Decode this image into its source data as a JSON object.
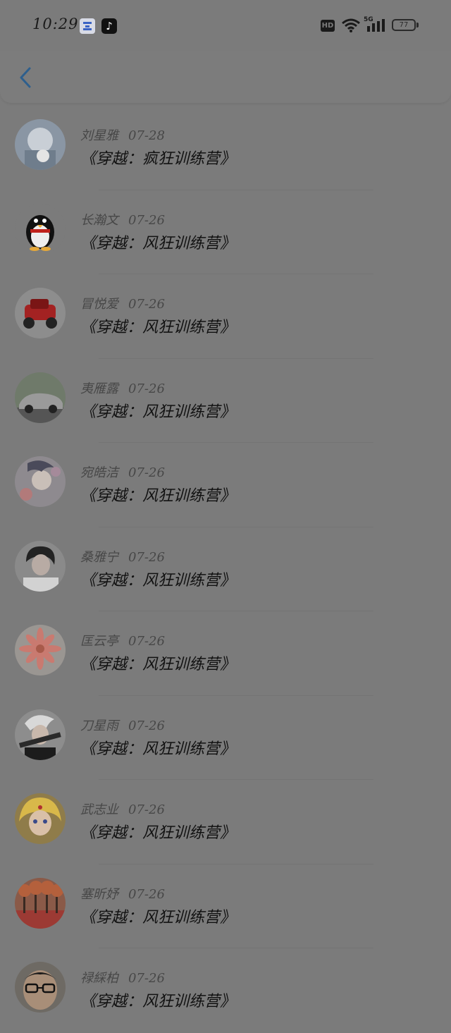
{
  "status_bar": {
    "time": "10:29",
    "hd": "HD",
    "network": "5G",
    "battery": "77"
  },
  "colors": {
    "accent": "#2e5f8d",
    "background": "#7b7b7b",
    "title_text": "#111111",
    "meta_text": "#474747"
  },
  "header": {
    "back_icon": "chevron-left-icon"
  },
  "list": [
    {
      "name": "刘星雅",
      "date": "07-28",
      "title": "《穿越：疯狂训练营》",
      "avatar": "anime-girl-cat"
    },
    {
      "name": "长瀚文",
      "date": "07-26",
      "title": "《穿越：风狂训练营》",
      "avatar": "penguin"
    },
    {
      "name": "冒悦爱",
      "date": "07-26",
      "title": "《穿越：风狂训练营》",
      "avatar": "red-toy-car"
    },
    {
      "name": "夷雁露",
      "date": "07-26",
      "title": "《穿越：风狂训练营》",
      "avatar": "silver-car"
    },
    {
      "name": "宛皓洁",
      "date": "07-26",
      "title": "《穿越：风狂训练营》",
      "avatar": "anime-flowers"
    },
    {
      "name": "桑雅宁",
      "date": "07-26",
      "title": "《穿越：风狂训练营》",
      "avatar": "young-man-portrait"
    },
    {
      "name": "匡云亭",
      "date": "07-26",
      "title": "《穿越：风狂训练营》",
      "avatar": "pink-daisy"
    },
    {
      "name": "刀星雨",
      "date": "07-26",
      "title": "《穿越：风狂训练营》",
      "avatar": "anime-boy-gun"
    },
    {
      "name": "武志业",
      "date": "07-26",
      "title": "《穿越：风狂训练营》",
      "avatar": "sailor-moon"
    },
    {
      "name": "塞昕妤",
      "date": "07-26",
      "title": "《穿越：风狂训练营》",
      "avatar": "autumn-trees"
    },
    {
      "name": "禄綵柏",
      "date": "07-26",
      "title": "《穿越：风狂训练营》",
      "avatar": "man-glasses"
    }
  ]
}
